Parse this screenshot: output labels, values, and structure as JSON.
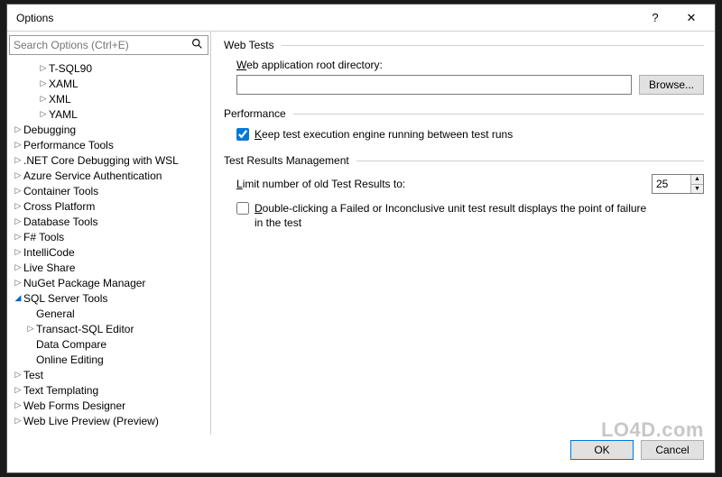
{
  "window": {
    "title": "Options",
    "help_label": "?",
    "close_label": "✕"
  },
  "search": {
    "placeholder": "Search Options (Ctrl+E)"
  },
  "tree": [
    {
      "label": "T-SQL90",
      "indent": 2,
      "caret": "closed"
    },
    {
      "label": "XAML",
      "indent": 2,
      "caret": "closed"
    },
    {
      "label": "XML",
      "indent": 2,
      "caret": "closed"
    },
    {
      "label": "YAML",
      "indent": 2,
      "caret": "closed"
    },
    {
      "label": "Debugging",
      "indent": 0,
      "caret": "closed"
    },
    {
      "label": "Performance Tools",
      "indent": 0,
      "caret": "closed"
    },
    {
      "label": ".NET Core Debugging with WSL",
      "indent": 0,
      "caret": "closed"
    },
    {
      "label": "Azure Service Authentication",
      "indent": 0,
      "caret": "closed"
    },
    {
      "label": "Container Tools",
      "indent": 0,
      "caret": "closed"
    },
    {
      "label": "Cross Platform",
      "indent": 0,
      "caret": "closed"
    },
    {
      "label": "Database Tools",
      "indent": 0,
      "caret": "closed"
    },
    {
      "label": "F# Tools",
      "indent": 0,
      "caret": "closed"
    },
    {
      "label": "IntelliCode",
      "indent": 0,
      "caret": "closed"
    },
    {
      "label": "Live Share",
      "indent": 0,
      "caret": "closed"
    },
    {
      "label": "NuGet Package Manager",
      "indent": 0,
      "caret": "closed"
    },
    {
      "label": "SQL Server Tools",
      "indent": 0,
      "caret": "expanded"
    },
    {
      "label": "General",
      "indent": 1,
      "caret": "none"
    },
    {
      "label": "Transact-SQL Editor",
      "indent": 1,
      "caret": "closed"
    },
    {
      "label": "Data Compare",
      "indent": 1,
      "caret": "none"
    },
    {
      "label": "Online Editing",
      "indent": 1,
      "caret": "none"
    },
    {
      "label": "Test",
      "indent": 0,
      "caret": "closed"
    },
    {
      "label": "Text Templating",
      "indent": 0,
      "caret": "closed"
    },
    {
      "label": "Web Forms Designer",
      "indent": 0,
      "caret": "closed"
    },
    {
      "label": "Web Live Preview (Preview)",
      "indent": 0,
      "caret": "closed"
    }
  ],
  "panel": {
    "web_tests": {
      "title": "Web Tests",
      "root_dir_label": "Web application root directory:",
      "root_dir_value": "",
      "browse_label": "Browse..."
    },
    "performance": {
      "title": "Performance",
      "keep_engine_label": "Keep test execution engine running between test runs",
      "keep_engine_checked": true
    },
    "results": {
      "title": "Test Results Management",
      "limit_label": "Limit number of old Test Results to:",
      "limit_value": "25",
      "double_click_label": "Double-clicking a Failed or Inconclusive unit test result displays the point of failure in the test",
      "double_click_checked": false
    }
  },
  "footer": {
    "ok": "OK",
    "cancel": "Cancel"
  },
  "watermark": "LO4D.com"
}
